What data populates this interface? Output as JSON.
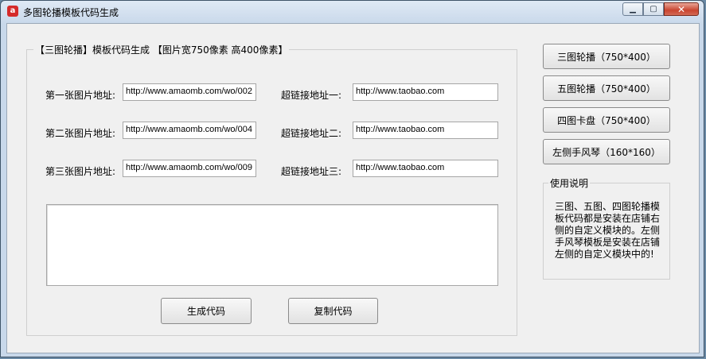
{
  "window": {
    "title": "多图轮播模板代码生成",
    "icon_letter": "a",
    "controls": {
      "minimize": "▁",
      "maximize": "▢",
      "close": "✕"
    }
  },
  "form": {
    "group_title": "【三图轮播】模板代码生成 【图片宽750像素 高400像素】",
    "rows": [
      {
        "image_label": "第一张图片地址:",
        "image_value": "http://www.amaomb.com/wo/002",
        "link_label": "超链接地址一:",
        "link_value": "http://www.taobao.com"
      },
      {
        "image_label": "第二张图片地址:",
        "image_value": "http://www.amaomb.com/wo/004",
        "link_label": "超链接地址二:",
        "link_value": "http://www.taobao.com"
      },
      {
        "image_label": "第三张图片地址:",
        "image_value": "http://www.amaomb.com/wo/009",
        "link_label": "超链接地址三:",
        "link_value": "http://www.taobao.com"
      }
    ],
    "output_value": "",
    "generate_label": "生成代码",
    "copy_label": "复制代码"
  },
  "templates": [
    {
      "label": "三图轮播（750*400）"
    },
    {
      "label": "五图轮播（750*400）"
    },
    {
      "label": "四图卡盘（750*400）"
    },
    {
      "label": "左侧手风琴（160*160）"
    }
  ],
  "help": {
    "title": "使用说明",
    "text": "三图、五图、四图轮播模板代码都是安装在店铺右侧的自定义模块的。左侧手风琴模板是安装在店铺左侧的自定义模块中的!"
  }
}
